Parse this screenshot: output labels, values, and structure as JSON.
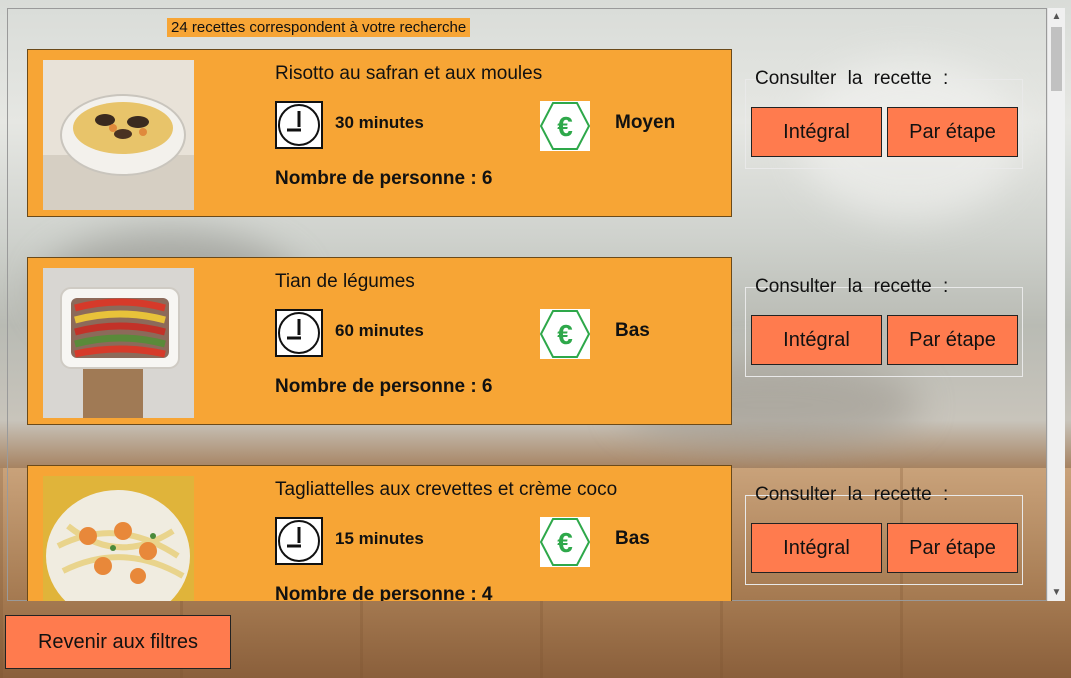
{
  "search": {
    "result_count": "24 recettes correspondent à votre recherche"
  },
  "consult_label": "Consulter la recette :",
  "buttons": {
    "integral": "Intégral",
    "steps": "Par étape",
    "back": "Revenir aux filtres"
  },
  "recipes": [
    {
      "title": "Risotto au safran et aux moules",
      "duration": "30 minutes",
      "cost": "Moyen",
      "people": "Nombre de personne : 6",
      "image": "risotto-photo"
    },
    {
      "title": "Tian de légumes",
      "duration": "60 minutes",
      "cost": "Bas",
      "people": "Nombre de personne : 6",
      "image": "tian-photo"
    },
    {
      "title": "Tagliattelles aux crevettes et crème coco",
      "duration": "15 minutes",
      "cost": "Bas",
      "people": "Nombre de personne : 4",
      "image": "tagliatelle-photo"
    }
  ],
  "icons": {
    "duration": "clock-icon",
    "cost": "euro-icon",
    "scroll_up": "chevron-up-icon",
    "scroll_down": "chevron-down-icon"
  },
  "colors": {
    "card": "#f7a535",
    "button": "#ff7b4e",
    "euro": "#2ea84a"
  }
}
